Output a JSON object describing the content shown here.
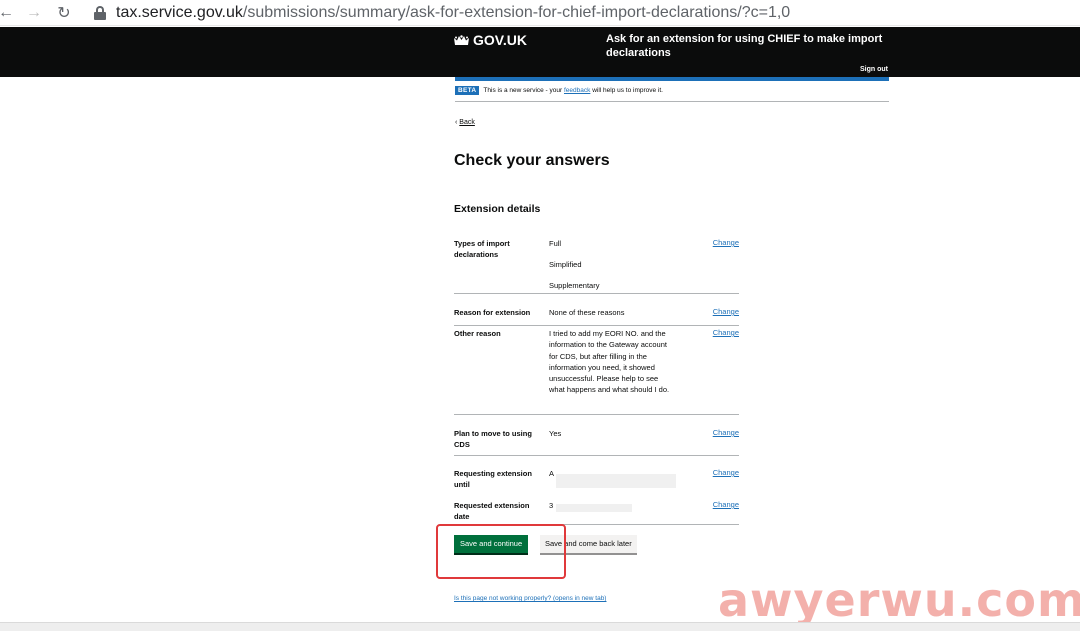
{
  "browser": {
    "domain": "tax.service.gov.uk",
    "path": "/submissions/summary/ask-for-extension-for-chief-import-declarations/?c=1,0"
  },
  "header": {
    "logo": "GOV.UK",
    "service_name": "Ask for an extension for using CHIEF to make import declarations",
    "sign_out": "Sign out"
  },
  "beta": {
    "tag": "BETA",
    "text_before": "This is a new service - your",
    "link": "feedback",
    "text_after": "will help us to improve it."
  },
  "back": "Back",
  "page_title": "Check your answers",
  "section_title": "Extension details",
  "rows": [
    {
      "key": "Types of import declarations",
      "values": [
        "Full",
        "Simplified",
        "Supplementary"
      ],
      "action": "Change"
    },
    {
      "key": "Reason for extension",
      "values": [
        "None of these reasons"
      ],
      "action": "Change"
    },
    {
      "key": "Other reason",
      "values": [
        "I tried to add my EORI NO. and the information to the Gateway account for CDS, but after filling in the information you need, it showed unsuccessful. Please help to see what happens and what should I do."
      ],
      "action": "Change"
    },
    {
      "key": "Plan to move to using CDS",
      "values": [
        "Yes"
      ],
      "action": "Change"
    },
    {
      "key": "Requesting extension until",
      "values": [
        "A"
      ],
      "action": "Change"
    },
    {
      "key": "Requested extension date",
      "values": [
        "3"
      ],
      "action": "Change"
    }
  ],
  "buttons": {
    "primary": "Save and continue",
    "secondary": "Save and come back later"
  },
  "help_link": "Is this page not working properly? (opens in new tab)",
  "watermark": "awyerwu.com"
}
